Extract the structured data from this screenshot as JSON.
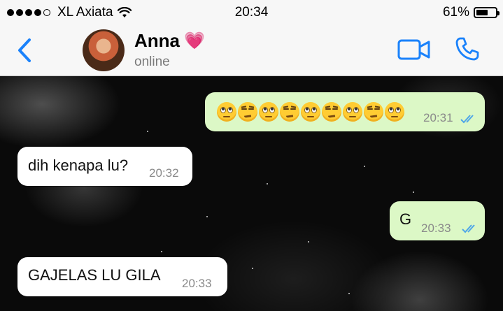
{
  "status_bar": {
    "carrier": "XL Axiata",
    "time": "20:34",
    "battery": "61%",
    "battery_level": 0.61,
    "signal_bars": 4,
    "signal_total": 5
  },
  "header": {
    "contact_name": "Anna",
    "name_emoji": "💗",
    "status": "online",
    "icons": [
      "back-chevron-icon",
      "video-call-icon",
      "phone-call-icon"
    ],
    "accent_color": "#1a82fb"
  },
  "messages": [
    {
      "direction": "outgoing",
      "text": "",
      "emojis": [
        "eye-roll",
        "unamused",
        "eye-roll",
        "unamused",
        "eye-roll",
        "unamused",
        "eye-roll",
        "unamused",
        "eye-roll"
      ],
      "time": "20:31",
      "read": true
    },
    {
      "direction": "incoming",
      "text": "dih kenapa lu?",
      "time": "20:32"
    },
    {
      "direction": "outgoing",
      "text": "G",
      "time": "20:33",
      "read": true
    },
    {
      "direction": "incoming",
      "text": "GAJELAS LU GILA",
      "time": "20:33"
    }
  ],
  "colors": {
    "outgoing_bubble": "#dcf8c6",
    "incoming_bubble": "#ffffff",
    "read_ticks": "#4fa6e8"
  }
}
